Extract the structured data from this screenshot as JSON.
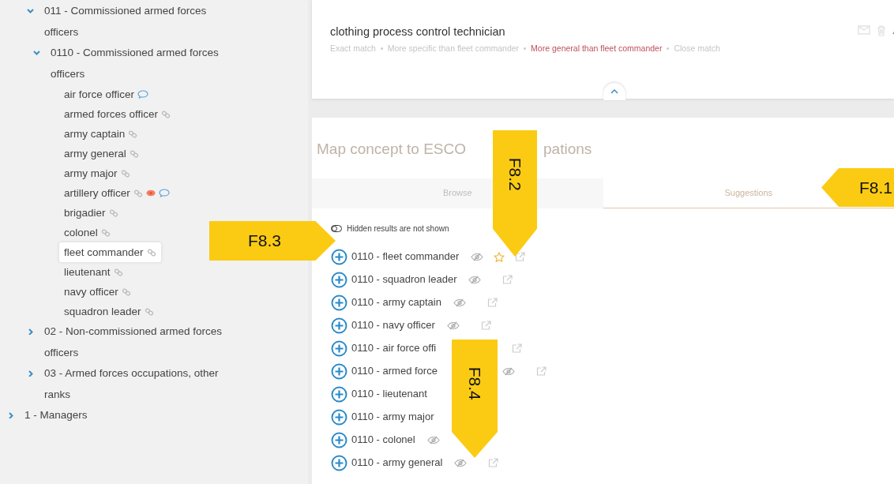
{
  "tree": {
    "continued": [
      {
        "label": "011 - Commissioned armed forces officers",
        "expanded": true,
        "children": [
          {
            "label": "0110 - Commissioned armed forces officers",
            "expanded": true,
            "children": [
              {
                "label": "air force officer",
                "linked": false,
                "flagged": false,
                "commented": true,
                "selected": false
              },
              {
                "label": "armed forces officer",
                "linked": true,
                "flagged": false,
                "commented": false,
                "selected": false
              },
              {
                "label": "army captain",
                "linked": true,
                "flagged": false,
                "commented": false,
                "selected": false
              },
              {
                "label": "army general",
                "linked": true,
                "flagged": false,
                "commented": false,
                "selected": false
              },
              {
                "label": "army major",
                "linked": true,
                "flagged": false,
                "commented": false,
                "selected": false
              },
              {
                "label": "artillery officer",
                "linked": true,
                "flagged": true,
                "commented": true,
                "selected": false
              },
              {
                "label": "brigadier",
                "linked": true,
                "flagged": false,
                "commented": false,
                "selected": false
              },
              {
                "label": "colonel",
                "linked": true,
                "flagged": false,
                "commented": false,
                "selected": false
              },
              {
                "label": "fleet commander",
                "linked": true,
                "flagged": false,
                "commented": false,
                "selected": true
              },
              {
                "label": "lieutenant",
                "linked": true,
                "flagged": false,
                "commented": false,
                "selected": false
              },
              {
                "label": "navy officer",
                "linked": true,
                "flagged": false,
                "commented": false,
                "selected": false
              },
              {
                "label": "squadron leader",
                "linked": true,
                "flagged": false,
                "commented": false,
                "selected": false
              }
            ]
          }
        ]
      },
      {
        "label": "02 - Non-commissioned armed forces officers",
        "expanded": false
      },
      {
        "label": "03 - Armed forces occupations, other ranks",
        "expanded": false
      }
    ],
    "nodes": [
      {
        "label": "1 - Managers",
        "expanded": false
      }
    ]
  },
  "concept": {
    "title": "clothing process control technician",
    "match_types": [
      {
        "label": "Exact match",
        "selected": false
      },
      {
        "label": "More specific than fleet commander",
        "selected": false
      },
      {
        "label": "More general than fleet commander",
        "selected": true
      },
      {
        "label": "Close match",
        "selected": false
      }
    ]
  },
  "mapping": {
    "title_parts": [
      "Map concept to ESCO",
      "pations"
    ],
    "tabs": [
      {
        "label": "Browse",
        "selected": false
      },
      {
        "label": "Suggestions",
        "selected": true
      }
    ],
    "hidden_toggle": {
      "label": "Hidden results are not shown",
      "on": false
    },
    "results": [
      {
        "label": "0110 - fleet commander",
        "hide_control": true,
        "starred": true,
        "open_link": true,
        "obscured": false
      },
      {
        "label": "0110 - squadron leader",
        "hide_control": true,
        "starred": false,
        "open_link": true,
        "obscured": false
      },
      {
        "label": "0110 - army captain",
        "hide_control": true,
        "starred": false,
        "open_link": true,
        "obscured": false
      },
      {
        "label": "0110 - navy officer",
        "hide_control": true,
        "starred": false,
        "open_link": true,
        "obscured": false
      },
      {
        "label": "0110 - air force offi",
        "hide_control": false,
        "starred": false,
        "open_link": true,
        "obscured": true
      },
      {
        "label": "0110 - armed force",
        "hide_control": true,
        "starred": false,
        "open_link": true,
        "obscured": true
      },
      {
        "label": "0110 - lieutenant",
        "hide_control": false,
        "starred": false,
        "open_link": false
      },
      {
        "label": "0110 - army major",
        "hide_control": false,
        "starred": false,
        "open_link": false
      },
      {
        "label": "0110 - colonel",
        "hide_control": true,
        "starred": false,
        "open_link": false,
        "obscured": false
      },
      {
        "label": "0110 - army general",
        "hide_control": true,
        "starred": false,
        "open_link": true,
        "obscured": false
      }
    ]
  },
  "callouts": [
    {
      "label": "F8.1",
      "kind": "left"
    },
    {
      "label": "F8.2",
      "kind": "down"
    },
    {
      "label": "F8.3",
      "kind": "right"
    },
    {
      "label": "F8.4",
      "kind": "down"
    }
  ]
}
